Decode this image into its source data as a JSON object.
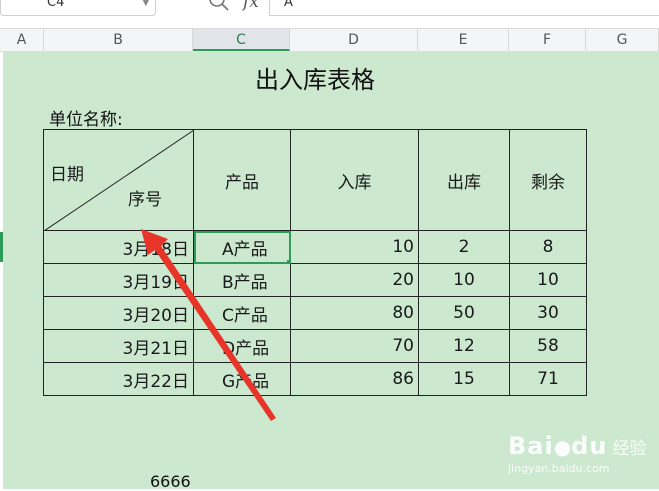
{
  "formula_bar": {
    "cell_ref": "C4",
    "fx": "fx",
    "content": "A"
  },
  "columns": [
    "A",
    "B",
    "C",
    "D",
    "E",
    "F",
    "G"
  ],
  "sheet": {
    "title": "出入库表格",
    "unit_label": "单位名称:",
    "header": {
      "date_label": "日期",
      "seq_label": "序号",
      "product": "产品",
      "in": "入库",
      "out": "出库",
      "remain": "剩余"
    },
    "rows": [
      {
        "date": "3月18日",
        "product": "A产品",
        "in": "10",
        "out": "2",
        "remain": "8"
      },
      {
        "date": "3月19日",
        "product": "B产品",
        "in": "20",
        "out": "10",
        "remain": "10"
      },
      {
        "date": "3月20日",
        "product": "C产品",
        "in": "80",
        "out": "50",
        "remain": "30"
      },
      {
        "date": "3月21日",
        "product": "D产品",
        "in": "70",
        "out": "12",
        "remain": "58"
      },
      {
        "date": "3月22日",
        "product": "G产品",
        "in": "86",
        "out": "15",
        "remain": "71"
      }
    ],
    "stray_value": "6666"
  },
  "watermark": {
    "brand": "Bai",
    "brand2": "du",
    "sub": "经验",
    "site": "jingyan.baidu.com"
  },
  "colors": {
    "sheet_bg": "#cce8cf",
    "accent": "#2e9b58",
    "arrow": "#e8352a"
  }
}
